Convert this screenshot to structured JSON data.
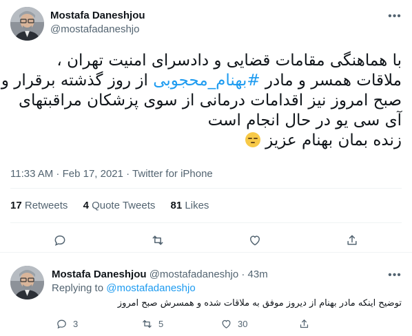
{
  "tweet": {
    "author_name": "Mostafa Daneshjou",
    "author_handle": "@mostafadaneshjo",
    "lines": [
      "با هماهنگی مقامات قضایی و دادسرای امنیت تهران ،",
      "صبح امروز نیز اقدامات درمانی از سوی پزشکان مراقبتهای",
      "آی سی یو در حال انجام است",
      "زنده بمان بهنام عزیز"
    ],
    "line2": {
      "before": "ملاقات همسر و مادر ",
      "hashtag": "#بهنام_محجوبی",
      "after": " از روز گذشته برقرار و"
    },
    "emoji": "pensive-face",
    "timestamp": "11:33 AM · Feb 17, 2021 · Twitter for iPhone",
    "stats": {
      "retweets_count": "17",
      "retweets_label": "Retweets",
      "quotes_count": "4",
      "quotes_label": "Quote Tweets",
      "likes_count": "81",
      "likes_label": "Likes"
    },
    "actions": [
      "reply-icon",
      "retweet-icon",
      "like-icon",
      "share-icon"
    ]
  },
  "reply": {
    "author_name": "Mostafa Daneshjou",
    "meta": "@mostafadaneshjo · 43m",
    "replying_prefix": "Replying to",
    "replying_handle": "@mostafadaneshjo",
    "text": "توضیح اینکه مادر بهنام از دیروز موفق به ملاقات شده و همسرش صبح امروز",
    "reply_count": "3",
    "retweet_count": "5",
    "like_count": "30"
  },
  "colors": {
    "text_primary": "#0f1419",
    "text_secondary": "#536471",
    "accent": "#1d9bf0",
    "divider": "#eff3f4"
  }
}
